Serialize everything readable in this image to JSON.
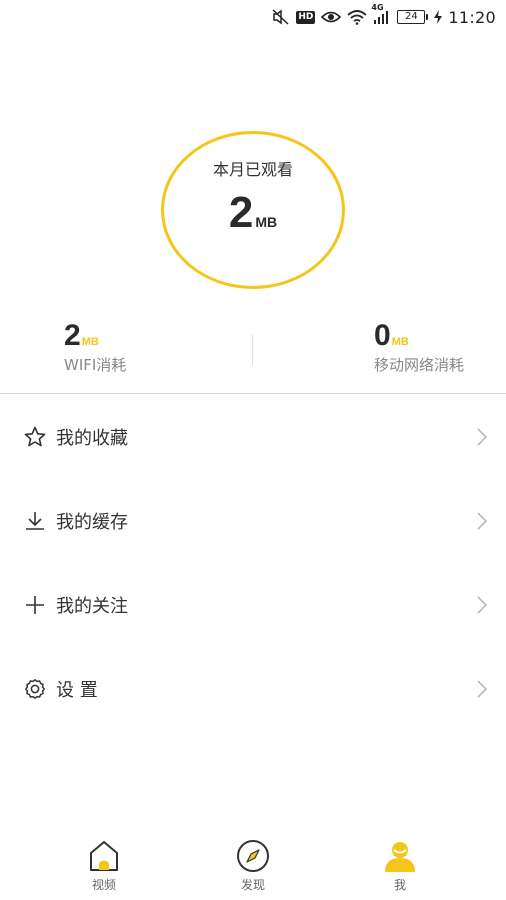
{
  "status_bar": {
    "network_type": "4G",
    "battery": "24",
    "time": "11:20",
    "icons": [
      "mute-icon",
      "hd-icon",
      "eye-icon",
      "wifi-icon",
      "signal-icon",
      "battery-icon",
      "charging-icon"
    ]
  },
  "usage": {
    "label": "本月已观看",
    "value": "2",
    "unit": "MB"
  },
  "stats": {
    "wifi": {
      "value": "2",
      "unit": "MB",
      "label": "WIFI消耗"
    },
    "mobile": {
      "value": "0",
      "unit": "MB",
      "label": "移动网络消耗"
    }
  },
  "menu": [
    {
      "icon": "star-icon",
      "label": "我的收藏"
    },
    {
      "icon": "download-icon",
      "label": "我的缓存"
    },
    {
      "icon": "plus-icon",
      "label": "我的关注"
    },
    {
      "icon": "gear-icon",
      "label": "设 置"
    }
  ],
  "nav": {
    "tabs": [
      {
        "icon": "home-icon",
        "label": "视频"
      },
      {
        "icon": "compass-icon",
        "label": "发现"
      },
      {
        "icon": "user-icon",
        "label": "我"
      }
    ],
    "active_color": "#f5c518"
  },
  "colors": {
    "accent": "#f5c518",
    "text": "#333333",
    "muted": "#888888"
  }
}
